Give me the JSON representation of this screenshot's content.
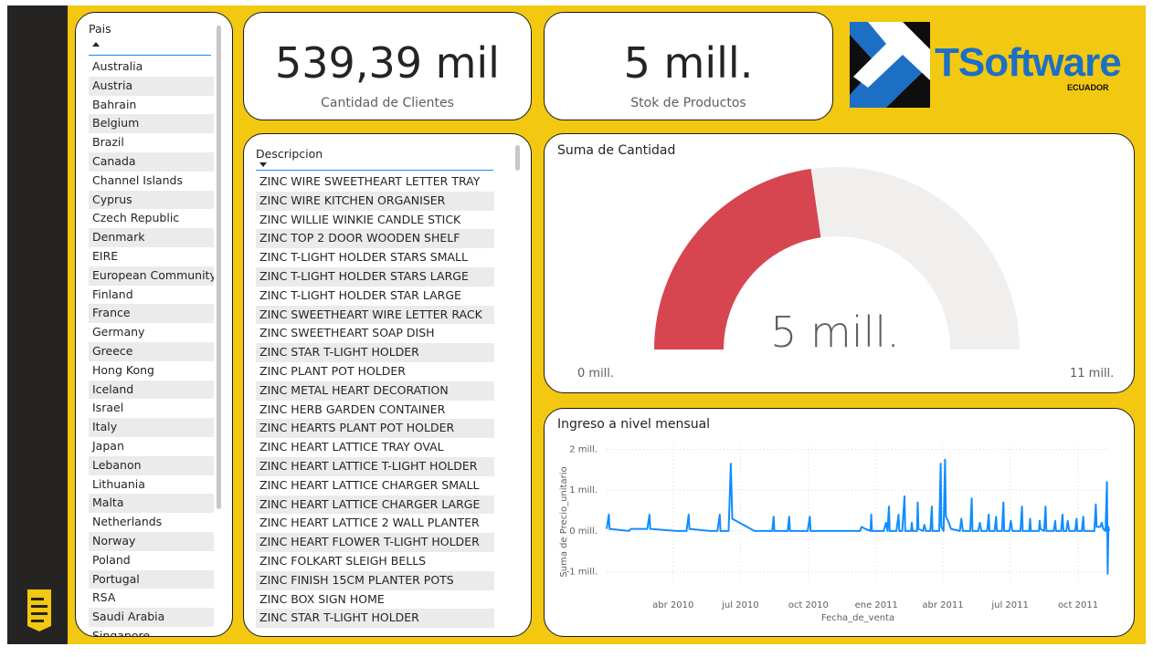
{
  "colors": {
    "accent": "#F2C811",
    "gauge_fill": "#D64550",
    "gauge_track": "#F0EFEE",
    "line": "#118DFF"
  },
  "pais_slicer": {
    "header": "Pais",
    "items": [
      "Australia",
      "Austria",
      "Bahrain",
      "Belgium",
      "Brazil",
      "Canada",
      "Channel Islands",
      "Cyprus",
      "Czech Republic",
      "Denmark",
      "EIRE",
      "European Community",
      "Finland",
      "France",
      "Germany",
      "Greece",
      "Hong Kong",
      "Iceland",
      "Israel",
      "Italy",
      "Japan",
      "Lebanon",
      "Lithuania",
      "Malta",
      "Netherlands",
      "Norway",
      "Poland",
      "Portugal",
      "RSA",
      "Saudi Arabia",
      "Singapore"
    ]
  },
  "kpi_clientes": {
    "value": "539,39 mil",
    "label": "Cantidad de Clientes"
  },
  "kpi_stock": {
    "value": "5 mill.",
    "label": "Stok de Productos"
  },
  "logo": {
    "brand": "TSoftware",
    "sub": "ECUADOR"
  },
  "descripcion_slicer": {
    "header": "Descripcion",
    "items": [
      "ZINC WIRE SWEETHEART LETTER TRAY",
      "ZINC WIRE KITCHEN ORGANISER",
      "ZINC WILLIE WINKIE CANDLE STICK",
      "ZINC TOP 2 DOOR WOODEN SHELF",
      "ZINC T-LIGHT HOLDER STARS SMALL",
      "ZINC T-LIGHT HOLDER STARS LARGE",
      "ZINC T-LIGHT HOLDER STAR LARGE",
      "ZINC SWEETHEART WIRE LETTER RACK",
      "ZINC SWEETHEART SOAP DISH",
      "ZINC STAR T-LIGHT HOLDER",
      "ZINC PLANT POT HOLDER",
      "ZINC METAL HEART DECORATION",
      "ZINC HERB GARDEN CONTAINER",
      "ZINC HEARTS PLANT POT HOLDER",
      "ZINC HEART LATTICE TRAY OVAL",
      "ZINC HEART LATTICE T-LIGHT HOLDER",
      "ZINC HEART LATTICE CHARGER SMALL",
      "ZINC HEART LATTICE CHARGER LARGE",
      "ZINC HEART LATTICE 2 WALL PLANTER",
      "ZINC HEART FLOWER T-LIGHT HOLDER",
      "ZINC FOLKART SLEIGH BELLS",
      "ZINC FINISH 15CM PLANTER POTS",
      "ZINC BOX SIGN HOME",
      "ZINC STAR T-LIGHT HOLDER"
    ]
  },
  "gauge": {
    "title": "Suma de Cantidad",
    "value_label": "5 mill.",
    "min_label": "0 mill.",
    "max_label": "11 mill.",
    "min": 0,
    "max": 11,
    "value": 5
  },
  "chart_data": {
    "type": "line",
    "title": "Ingreso a nivel mensual",
    "xlabel": "Fecha_de_venta",
    "ylabel": "Suma de Precio_unitario",
    "ylim": [
      -1.3,
      2.1
    ],
    "x_ticks": [
      "abr 2010",
      "jul 2010",
      "oct 2010",
      "ene 2011",
      "abr 2011",
      "jul 2011",
      "oct 2011"
    ],
    "x_tick_days": [
      90,
      181,
      273,
      365,
      455,
      546,
      638
    ],
    "y_ticks": [
      2,
      1,
      0,
      -1
    ],
    "y_tick_labels": [
      "2 mill.",
      "1 mill.",
      "0 mill.",
      "-1 mill."
    ],
    "grid": true,
    "series": [
      {
        "values": [
          [
            0,
            0.05
          ],
          [
            3,
            0.4
          ],
          [
            4,
            0.05
          ],
          [
            30,
            0.0
          ],
          [
            33,
            0.05
          ],
          [
            55,
            0.05
          ],
          [
            58,
            0.4
          ],
          [
            59,
            0.05
          ],
          [
            95,
            0.0
          ],
          [
            108,
            0.0
          ],
          [
            111,
            0.4
          ],
          [
            112,
            0.05
          ],
          [
            140,
            0.0
          ],
          [
            150,
            0.0
          ],
          [
            153,
            0.4
          ],
          [
            154,
            0.0
          ],
          [
            165,
            0.0
          ],
          [
            168,
            1.65
          ],
          [
            170,
            0.3
          ],
          [
            200,
            0.0
          ],
          [
            224,
            0.0
          ],
          [
            226,
            0.35
          ],
          [
            227,
            0.0
          ],
          [
            245,
            0.0
          ],
          [
            247,
            0.35
          ],
          [
            248,
            0.0
          ],
          [
            272,
            0.0
          ],
          [
            275,
            0.35
          ],
          [
            276,
            0.0
          ],
          [
            335,
            0.0
          ],
          [
            343,
            0.0
          ],
          [
            345,
            0.1
          ],
          [
            350,
            0.05
          ],
          [
            357,
            0.0
          ],
          [
            358,
            0.4
          ],
          [
            359,
            0.0
          ],
          [
            375,
            0.0
          ],
          [
            378,
            0.2
          ],
          [
            380,
            0.0
          ],
          [
            382,
            0.6
          ],
          [
            383,
            0.0
          ],
          [
            392,
            0.0
          ],
          [
            395,
            0.4
          ],
          [
            396,
            0.0
          ],
          [
            400,
            0.0
          ],
          [
            403,
            0.85
          ],
          [
            404,
            0.0
          ],
          [
            412,
            0.0
          ],
          [
            413,
            0.2
          ],
          [
            414,
            0.0
          ],
          [
            420,
            0.0
          ],
          [
            421,
            0.7
          ],
          [
            422,
            0.05
          ],
          [
            428,
            0.0
          ],
          [
            430,
            0.15
          ],
          [
            432,
            0.0
          ],
          [
            438,
            0.0
          ],
          [
            440,
            0.6
          ],
          [
            441,
            0.0
          ],
          [
            450,
            0.0
          ],
          [
            452,
            1.65
          ],
          [
            453,
            0.1
          ],
          [
            456,
            0.0
          ],
          [
            458,
            1.75
          ],
          [
            459,
            0.35
          ],
          [
            462,
            0.25
          ],
          [
            466,
            0.05
          ],
          [
            478,
            0.0
          ],
          [
            480,
            0.3
          ],
          [
            482,
            0.0
          ],
          [
            492,
            0.0
          ],
          [
            494,
            0.8
          ],
          [
            495,
            0.0
          ],
          [
            503,
            0.0
          ],
          [
            505,
            0.2
          ],
          [
            507,
            0.0
          ],
          [
            515,
            0.0
          ],
          [
            517,
            0.4
          ],
          [
            518,
            0.0
          ],
          [
            525,
            0.0
          ],
          [
            527,
            0.35
          ],
          [
            528,
            0.0
          ],
          [
            535,
            0.0
          ],
          [
            537,
            0.7
          ],
          [
            538,
            0.0
          ],
          [
            545,
            0.0
          ],
          [
            547,
            0.25
          ],
          [
            549,
            0.0
          ],
          [
            560,
            0.0
          ],
          [
            562,
            0.6
          ],
          [
            563,
            0.0
          ],
          [
            572,
            0.0
          ],
          [
            573,
            0.3
          ],
          [
            574,
            0.0
          ],
          [
            585,
            0.0
          ],
          [
            586,
            0.25
          ],
          [
            587,
            0.05
          ],
          [
            592,
            0.0
          ],
          [
            594,
            0.6
          ],
          [
            595,
            0.0
          ],
          [
            605,
            0.0
          ],
          [
            607,
            0.25
          ],
          [
            608,
            0.0
          ],
          [
            615,
            0.0
          ],
          [
            617,
            0.4
          ],
          [
            618,
            0.0
          ],
          [
            622,
            0.0
          ],
          [
            624,
            0.25
          ],
          [
            626,
            0.0
          ],
          [
            634,
            0.0
          ],
          [
            636,
            0.3
          ],
          [
            637,
            0.0
          ],
          [
            643,
            0.0
          ],
          [
            645,
            0.35
          ],
          [
            646,
            0.0
          ],
          [
            660,
            0.0
          ],
          [
            662,
            0.65
          ],
          [
            663,
            0.1
          ],
          [
            668,
            0.1
          ],
          [
            670,
            0.2
          ],
          [
            672,
            0.05
          ],
          [
            675,
            0.0
          ],
          [
            677,
            1.2
          ],
          [
            678,
            -1.05
          ],
          [
            679,
            0.1
          ],
          [
            680,
            0.0
          ]
        ]
      }
    ]
  }
}
